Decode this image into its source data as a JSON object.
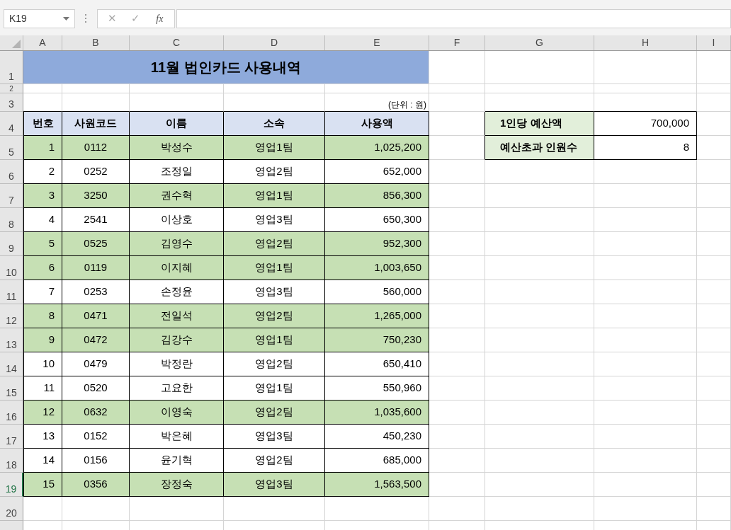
{
  "name_box": "K19",
  "formula_bar": {
    "cancel_glyph": "✕",
    "enter_glyph": "✓",
    "function_label": "fx"
  },
  "column_headers": [
    "A",
    "B",
    "C",
    "D",
    "E",
    "F",
    "G",
    "H",
    "I"
  ],
  "row_headers": [
    {
      "label": "1",
      "selected": false
    },
    {
      "label": "2",
      "selected": false
    },
    {
      "label": "3",
      "selected": false
    },
    {
      "label": "4",
      "selected": false
    },
    {
      "label": "5",
      "selected": false
    },
    {
      "label": "6",
      "selected": false
    },
    {
      "label": "7",
      "selected": false
    },
    {
      "label": "8",
      "selected": false
    },
    {
      "label": "9",
      "selected": false
    },
    {
      "label": "10",
      "selected": false
    },
    {
      "label": "11",
      "selected": false
    },
    {
      "label": "12",
      "selected": false
    },
    {
      "label": "13",
      "selected": false
    },
    {
      "label": "14",
      "selected": false
    },
    {
      "label": "15",
      "selected": false
    },
    {
      "label": "16",
      "selected": false
    },
    {
      "label": "17",
      "selected": false
    },
    {
      "label": "18",
      "selected": false
    },
    {
      "label": "19",
      "selected": true
    },
    {
      "label": "20",
      "selected": false
    }
  ],
  "title": "11월 법인카드 사용내역",
  "unit_note": "(단위 : 원)",
  "table": {
    "columns": [
      "번호",
      "사원코드",
      "이름",
      "소속",
      "사용액"
    ],
    "rows": [
      {
        "cells": [
          "1",
          "0112",
          "박성수",
          "영업1팀",
          "1,025,200"
        ],
        "highlighted": true
      },
      {
        "cells": [
          "2",
          "0252",
          "조정일",
          "영업2팀",
          "652,000"
        ],
        "highlighted": false
      },
      {
        "cells": [
          "3",
          "3250",
          "권수혁",
          "영업1팀",
          "856,300"
        ],
        "highlighted": true
      },
      {
        "cells": [
          "4",
          "2541",
          "이상호",
          "영업3팀",
          "650,300"
        ],
        "highlighted": false
      },
      {
        "cells": [
          "5",
          "0525",
          "김영수",
          "영업2팀",
          "952,300"
        ],
        "highlighted": true
      },
      {
        "cells": [
          "6",
          "0119",
          "이지혜",
          "영업1팀",
          "1,003,650"
        ],
        "highlighted": true
      },
      {
        "cells": [
          "7",
          "0253",
          "손정윤",
          "영업3팀",
          "560,000"
        ],
        "highlighted": false
      },
      {
        "cells": [
          "8",
          "0471",
          "전일석",
          "영업2팀",
          "1,265,000"
        ],
        "highlighted": true
      },
      {
        "cells": [
          "9",
          "0472",
          "김강수",
          "영업1팀",
          "750,230"
        ],
        "highlighted": true
      },
      {
        "cells": [
          "10",
          "0479",
          "박정란",
          "영업2팀",
          "650,410"
        ],
        "highlighted": false
      },
      {
        "cells": [
          "11",
          "0520",
          "고요한",
          "영업1팀",
          "550,960"
        ],
        "highlighted": false
      },
      {
        "cells": [
          "12",
          "0632",
          "이영숙",
          "영업2팀",
          "1,035,600"
        ],
        "highlighted": true
      },
      {
        "cells": [
          "13",
          "0152",
          "박은혜",
          "영업3팀",
          "450,230"
        ],
        "highlighted": false
      },
      {
        "cells": [
          "14",
          "0156",
          "윤기혁",
          "영업2팀",
          "685,000"
        ],
        "highlighted": false
      },
      {
        "cells": [
          "15",
          "0356",
          "장정숙",
          "영업3팀",
          "1,563,500"
        ],
        "highlighted": true
      }
    ]
  },
  "summary": [
    {
      "label": "1인당 예산액",
      "value": "700,000"
    },
    {
      "label": "예산초과 인원수",
      "value": "8"
    }
  ]
}
